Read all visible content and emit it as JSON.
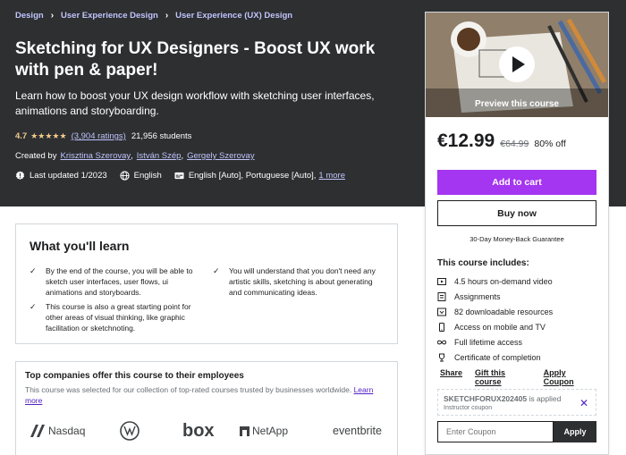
{
  "breadcrumb": [
    "Design",
    "User Experience Design",
    "User Experience (UX) Design"
  ],
  "course": {
    "title": "Sketching for UX Designers - Boost UX work with pen & paper!",
    "subtitle": "Learn how to boost your UX design workflow with sketching user interfaces, animations and storyboarding.",
    "rating": "4.7",
    "stars": "★★★★★",
    "ratings_count": "(3,904 ratings)",
    "students": "21,956 students",
    "created_by_label": "Created by",
    "authors": [
      "Krisztina Szerovay",
      "István Szép",
      "Gergely Szerovay"
    ],
    "last_updated": "Last updated 1/2023",
    "language": "English",
    "captions": "English [Auto], Portuguese [Auto],",
    "captions_more": "1 more"
  },
  "sidebar": {
    "preview_label": "Preview this course",
    "price": "€12.99",
    "old_price": "€64.99",
    "discount": "80% off",
    "add_to_cart": "Add to cart",
    "buy_now": "Buy now",
    "guarantee": "30-Day Money-Back Guarantee",
    "includes_title": "This course includes:",
    "includes": [
      {
        "icon": "video-icon",
        "label": "4.5 hours on-demand video"
      },
      {
        "icon": "assignment-icon",
        "label": "Assignments"
      },
      {
        "icon": "download-icon",
        "label": "82 downloadable resources"
      },
      {
        "icon": "mobile-icon",
        "label": "Access on mobile and TV"
      },
      {
        "icon": "infinity-icon",
        "label": "Full lifetime access"
      },
      {
        "icon": "trophy-icon",
        "label": "Certificate of completion"
      }
    ],
    "actions": [
      "Share",
      "Gift this course",
      "Apply Coupon"
    ],
    "coupon_code": "SKETCHFORUX202405",
    "coupon_applied": "is applied",
    "coupon_sub": "Instructor coupon",
    "coupon_placeholder": "Enter Coupon",
    "apply_label": "Apply"
  },
  "learn": {
    "title": "What you'll learn",
    "items": [
      "By the end of the course, you will be able to sketch user interfaces, user flows, ui animations and storyboards.",
      "You will understand that you don't need any artistic skills, sketching is about generating and communicating ideas.",
      "This course is also a great starting point for other areas of visual thinking, like graphic facilitation or sketchnoting."
    ]
  },
  "companies": {
    "title": "Top companies offer this course to their employees",
    "description": "This course was selected for our collection of top-rated courses trusted by businesses worldwide.",
    "learn_more": "Learn more",
    "logos": [
      "Nasdaq",
      "Volkswagen",
      "box",
      "NetApp",
      "eventbrite"
    ]
  },
  "colors": {
    "dark": "#2d2f31",
    "purple": "#a435f0",
    "link": "#c0c4fc",
    "star": "#f3ca8c"
  }
}
